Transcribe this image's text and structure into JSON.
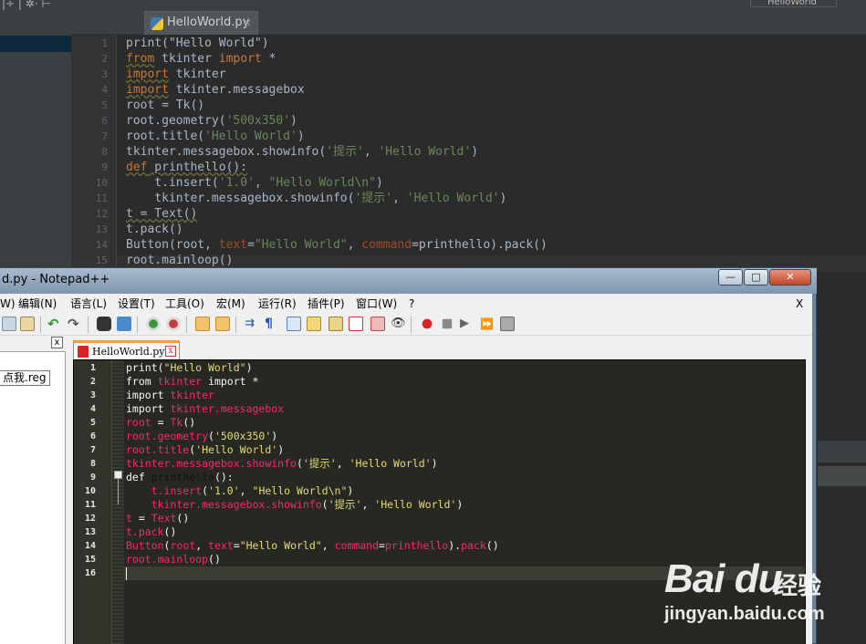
{
  "pycharm": {
    "toolbar_glyphs": "|÷ | ✲· ⊢",
    "tab": {
      "label": "HelloWorld.py",
      "close": "×"
    },
    "run_config": "HelloWorld",
    "lines": [
      {
        "n": "1"
      },
      {
        "n": "2"
      },
      {
        "n": "3"
      },
      {
        "n": "4"
      },
      {
        "n": "5"
      },
      {
        "n": "6"
      },
      {
        "n": "7"
      },
      {
        "n": "8"
      },
      {
        "n": "9"
      },
      {
        "n": "10"
      },
      {
        "n": "11"
      },
      {
        "n": "12"
      },
      {
        "n": "13"
      },
      {
        "n": "14"
      },
      {
        "n": "15"
      }
    ],
    "code": {
      "l1": "print(\"Hello World\")",
      "l2a": "from",
      "l2b": " tkinter ",
      "l2c": "import",
      "l2d": " *",
      "l3a": "import",
      "l3b": " tkinter",
      "l4a": "import",
      "l4b": " tkinter.messagebox",
      "l5": "root = Tk()",
      "l6a": "root.geometry(",
      "l6b": "'500x350'",
      "l6c": ")",
      "l7a": "root.title(",
      "l7b": "'Hello World'",
      "l7c": ")",
      "l8a": "tkinter.messagebox.showinfo(",
      "l8b": "'提示'",
      "l8c": ", ",
      "l8d": "'Hello World'",
      "l8e": ")",
      "l9a": "def",
      "l9b": " printhello():",
      "l10a": "    t.insert(",
      "l10b": "'1.0'",
      "l10c": ", ",
      "l10d": "\"Hello World\\n\"",
      "l10e": ")",
      "l11a": "    tkinter.messagebox.showinfo(",
      "l11b": "'提示'",
      "l11c": ", ",
      "l11d": "'Hello World'",
      "l11e": ")",
      "l12": "t = Text()",
      "l13": "t.pack()",
      "l14a": "Button(root, ",
      "l14b": "text",
      "l14c": "=",
      "l14d": "\"Hello World\"",
      "l14e": ", ",
      "l14f": "command",
      "l14g": "=printhello).pack()",
      "l15": "root.mainloop()"
    }
  },
  "notepadpp": {
    "title": "d.py - Notepad++",
    "window_buttons": {
      "min": "—",
      "max": "□",
      "close": "✕"
    },
    "menu": [
      "W)",
      "编辑(N)",
      "语言(L)",
      "设置(T)",
      "工具(O)",
      "宏(M)",
      "运行(R)",
      "插件(P)",
      "窗口(W)",
      "?"
    ],
    "menu_close": "X",
    "doclist": {
      "close": "x",
      "item": "点我.reg"
    },
    "tab": {
      "label": "HelloWorld.py",
      "close": "x"
    },
    "lines": [
      "1",
      "2",
      "3",
      "4",
      "5",
      "6",
      "7",
      "8",
      "9",
      "10",
      "11",
      "12",
      "13",
      "14",
      "15",
      "16"
    ],
    "code": {
      "l1a": "print(",
      "l1b": "\"Hello World\"",
      "l1c": ")",
      "l2a": "from ",
      "l2b": "tkinter",
      "l2c": " import *",
      "l3a": "import ",
      "l3b": "tkinter",
      "l4a": "import ",
      "l4b": "tkinter.messagebox",
      "l5a": "root",
      "l5b": " = ",
      "l5c": "Tk",
      "l5d": "()",
      "l6a": "root.geometry",
      "l6b": "(",
      "l6c": "'500x350'",
      "l6d": ")",
      "l7a": "root.title",
      "l7b": "(",
      "l7c": "'Hello World'",
      "l7d": ")",
      "l8a": "tkinter.messagebox.showinfo",
      "l8b": "(",
      "l8c": "'提示'",
      "l8d": ", ",
      "l8e": "'Hello World'",
      "l8f": ")",
      "l9a": "def ",
      "l9b": "printhello",
      "l9c": "():",
      "l10a": "    t.insert",
      "l10b": "(",
      "l10c": "'1.0'",
      "l10d": ", ",
      "l10e": "\"Hello World\\n\"",
      "l10f": ")",
      "l11a": "    tkinter.messagebox.showinfo",
      "l11b": "(",
      "l11c": "'提示'",
      "l11d": ", ",
      "l11e": "'Hello World'",
      "l11f": ")",
      "l12a": "t",
      "l12b": " = ",
      "l12c": "Text",
      "l12d": "()",
      "l13a": "t.pack",
      "l13b": "()",
      "l14a": "Button",
      "l14b": "(",
      "l14c": "root",
      ", ": "",
      "l14d": ", ",
      "l14e": "text",
      "l14f": "=",
      "l14g": "\"Hello World\"",
      "l14h": ", ",
      "l14i": "command",
      "l14j": "=",
      "l14k": "printhello",
      "l14l": ").",
      "l14m": "pack",
      "l14n": "()",
      "l15a": "root.mainloop",
      "l15b": "()"
    }
  },
  "watermark": {
    "logo": "Bai du",
    "cn": "经验",
    "url": "jingyan.baidu.com"
  },
  "colors": {
    "pycharm_bg": "#2b2b2b",
    "npp_bg": "#272822",
    "keyword": "#cc7832",
    "string": "#6a8759",
    "npp_keyword": "#f92672",
    "npp_string": "#e6db74",
    "npp_func": "#66d9ef"
  }
}
